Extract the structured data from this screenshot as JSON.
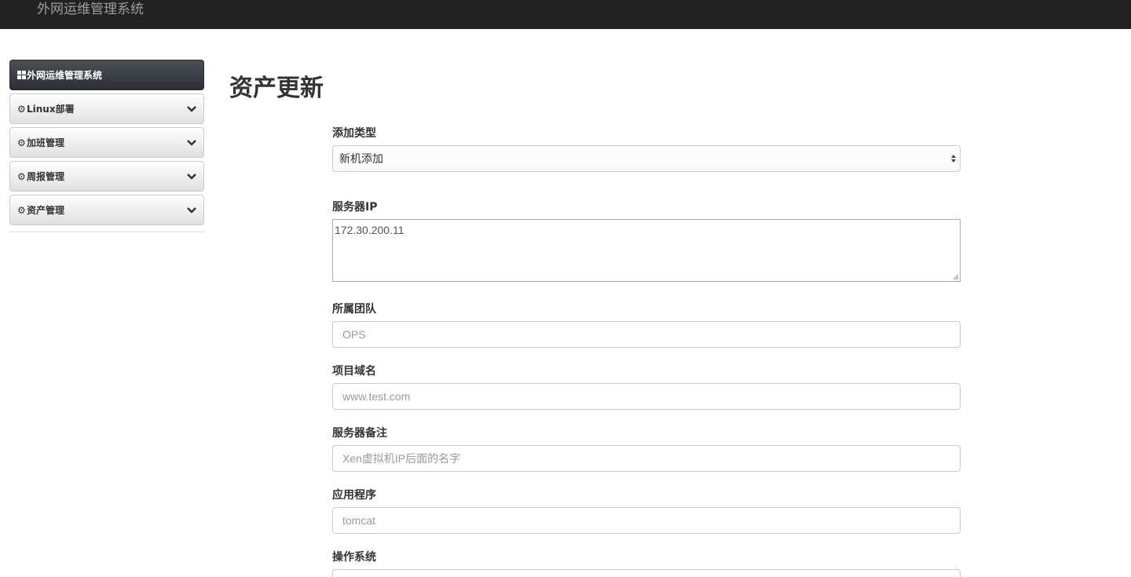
{
  "navbar": {
    "brand": "外网运维管理系统"
  },
  "sidebar": {
    "items": [
      {
        "label": "外网运维管理系统",
        "icon": "grid-icon",
        "active": true
      },
      {
        "label": "Linux部署",
        "icon": "cog-icon",
        "active": false
      },
      {
        "label": "加班管理",
        "icon": "cog-icon",
        "active": false
      },
      {
        "label": "周报管理",
        "icon": "cog-icon",
        "active": false
      },
      {
        "label": "资产管理",
        "icon": "cog-icon",
        "active": false
      }
    ]
  },
  "main": {
    "title": "资产更新",
    "form": {
      "add_type": {
        "label": "添加类型",
        "value": "新机添加"
      },
      "server_ip": {
        "label": "服务器IP",
        "value": "172.30.200.11"
      },
      "team": {
        "label": "所属团队",
        "placeholder": "OPS"
      },
      "domain": {
        "label": "项目域名",
        "placeholder": "www.test.com"
      },
      "remark": {
        "label": "服务器备注",
        "placeholder": "Xen虚拟机IP后面的名字"
      },
      "app": {
        "label": "应用程序",
        "placeholder": "tomcat"
      },
      "os": {
        "label": "操作系统"
      }
    }
  },
  "colors": {
    "navbar_bg": "#222222",
    "brand_text": "#9d9d9d",
    "active_item_bg": "#3a3f45"
  }
}
